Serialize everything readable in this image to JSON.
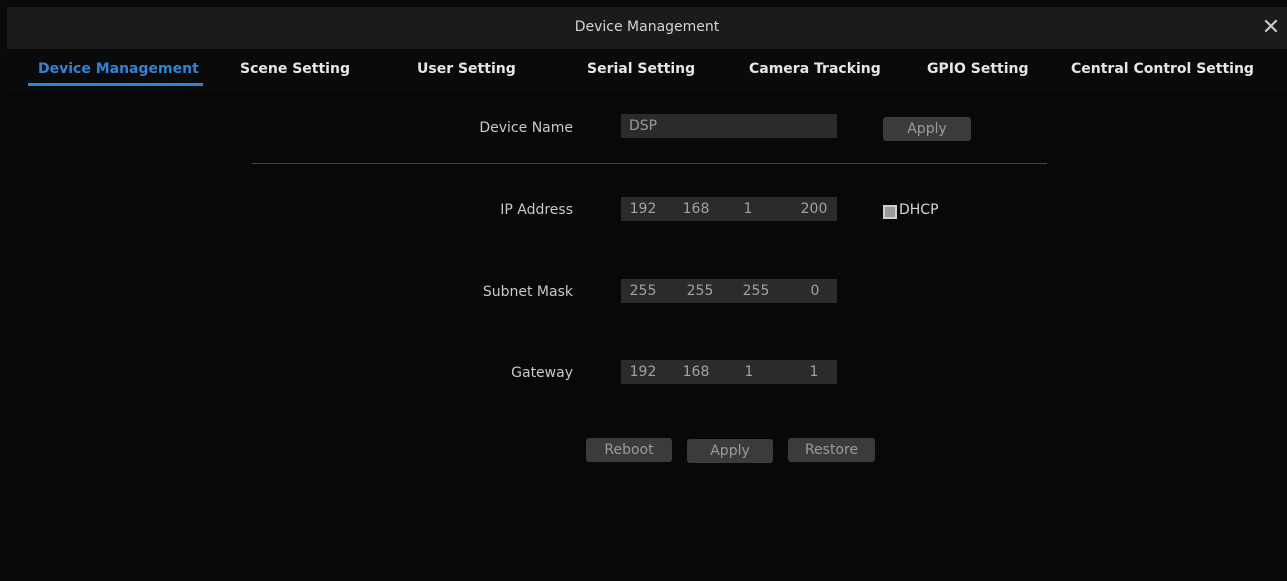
{
  "window": {
    "title": "Device Management"
  },
  "tabs": [
    {
      "label": "Device Management",
      "active": true
    },
    {
      "label": "Scene Setting"
    },
    {
      "label": "User Setting"
    },
    {
      "label": "Serial Setting"
    },
    {
      "label": "Camera Tracking"
    },
    {
      "label": "GPIO Setting"
    },
    {
      "label": "Central Control Setting"
    }
  ],
  "device_name": {
    "label": "Device Name",
    "value": "DSP",
    "apply": "Apply"
  },
  "ip_address": {
    "label": "IP Address",
    "octets": [
      "192",
      "168",
      "1",
      "200"
    ],
    "dhcp_label": "DHCP",
    "dhcp_checked": true
  },
  "subnet_mask": {
    "label": "Subnet Mask",
    "octets": [
      "255",
      "255",
      "255",
      "0"
    ]
  },
  "gateway": {
    "label": "Gateway",
    "octets": [
      "192",
      "168",
      "1",
      "1"
    ]
  },
  "actions": {
    "reboot": "Reboot",
    "apply": "Apply",
    "restore": "Restore"
  },
  "colors": {
    "accent": "#2f84d6",
    "background": "#080808",
    "titlebar": "#1b1b1b",
    "field": "#2b2b2b",
    "button": "#3b3b3b"
  }
}
